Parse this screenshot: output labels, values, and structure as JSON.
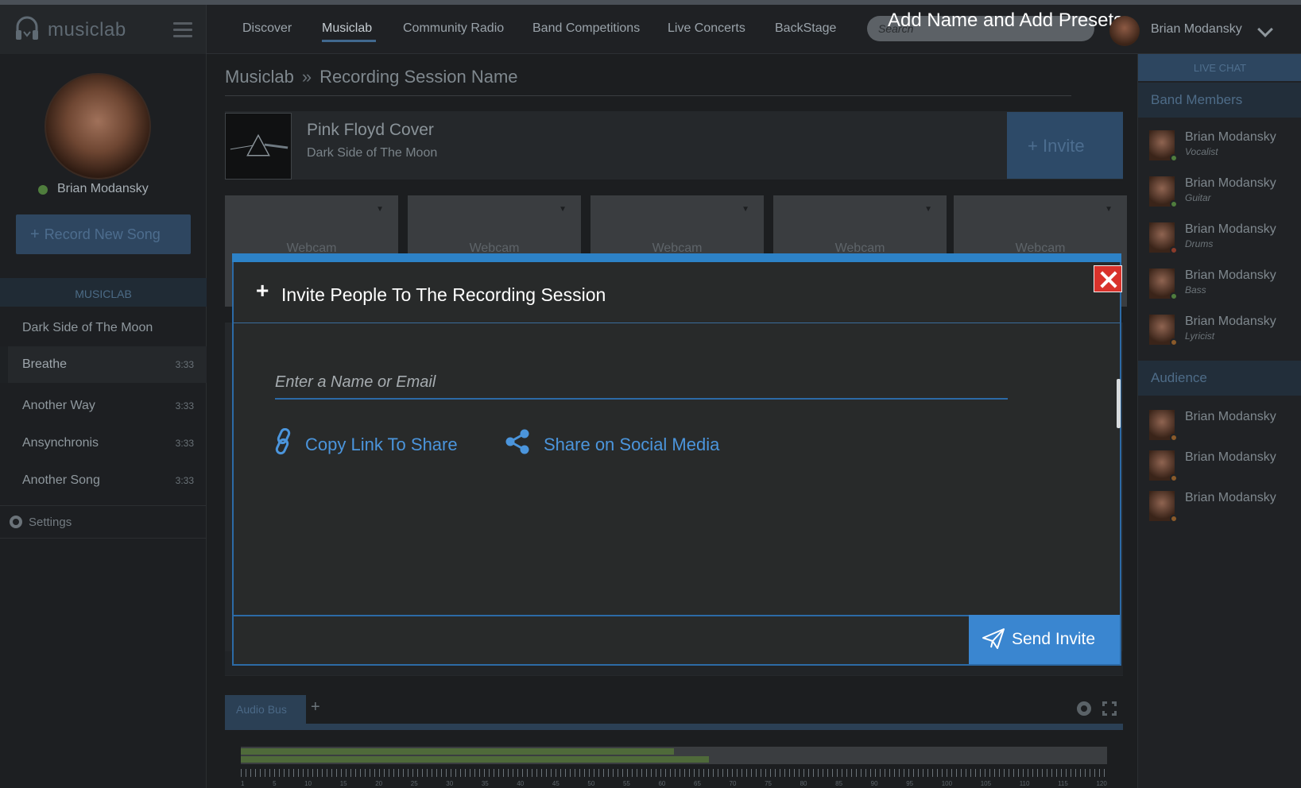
{
  "overlay_caption": "Add Name and Add Presets",
  "brand": {
    "name": "musiclab"
  },
  "nav": {
    "items": [
      {
        "label": "Discover"
      },
      {
        "label": "Musiclab"
      },
      {
        "label": "Community Radio"
      },
      {
        "label": "Band Competitions"
      },
      {
        "label": "Live Concerts"
      },
      {
        "label": "BackStage"
      }
    ],
    "active": "Musiclab",
    "search_placeholder": "Search",
    "user_name": "Brian Modansky"
  },
  "sidebar": {
    "profile_name": "Brian Modansky",
    "record_button": "Record New Song",
    "section_title": "MUSICLAB",
    "songs": [
      {
        "title": "Dark Side of The Moon",
        "duration": ""
      },
      {
        "title": "Breathe",
        "duration": "3:33"
      },
      {
        "title": "Another Way",
        "duration": "3:33"
      },
      {
        "title": "Ansynchronis",
        "duration": "3:33"
      },
      {
        "title": "Another Song",
        "duration": "3:33"
      }
    ],
    "settings_label": "Settings"
  },
  "main": {
    "breadcrumb": {
      "root": "Musiclab",
      "separator": "»",
      "current": "Recording Session Name"
    },
    "song_card": {
      "title": "Pink Floyd Cover",
      "subtitle": "Dark Side of The Moon",
      "invite_label": "Invite"
    },
    "webcams": [
      "Webcam",
      "Webcam",
      "Webcam",
      "Webcam",
      "Webcam"
    ],
    "audio_tab": "Audio Bus",
    "meter_levels": [
      0.5,
      0.54
    ],
    "ruler_numbers": [
      "1",
      "5",
      "10",
      "15",
      "20",
      "25",
      "30",
      "35",
      "40",
      "45",
      "50",
      "55",
      "60",
      "65",
      "70",
      "75",
      "80",
      "85",
      "90",
      "95",
      "100",
      "105",
      "110",
      "115",
      "120"
    ]
  },
  "right_panel": {
    "live_chat": "LIVE CHAT",
    "band_members_title": "Band Members",
    "band_members": [
      {
        "name": "Brian Modansky",
        "role": "Vocalist",
        "status_color": "#4f7d3d"
      },
      {
        "name": "Brian Modansky",
        "role": "Guitar",
        "status_color": "#4f7d3d"
      },
      {
        "name": "Brian Modansky",
        "role": "Drums",
        "status_color": "#8a3a2a"
      },
      {
        "name": "Brian Modansky",
        "role": "Bass",
        "status_color": "#4f7d3d"
      },
      {
        "name": "Brian Modansky",
        "role": "Lyricist",
        "status_color": "#8a5a2a"
      }
    ],
    "audience_title": "Audience",
    "audience": [
      {
        "name": "Brian Modansky",
        "status_color": "#8a5a2a"
      },
      {
        "name": "Brian Modansky",
        "status_color": "#8a5a2a"
      },
      {
        "name": "Brian Modansky",
        "status_color": "#8a5a2a"
      }
    ]
  },
  "modal": {
    "title": "Invite People To The Recording Session",
    "input_placeholder": "Enter a Name or Email",
    "input_value": "",
    "copy_link_label": "Copy Link To Share",
    "share_social_label": "Share on Social Media",
    "send_label": "Send Invite",
    "accent_color": "#2d82c7"
  }
}
